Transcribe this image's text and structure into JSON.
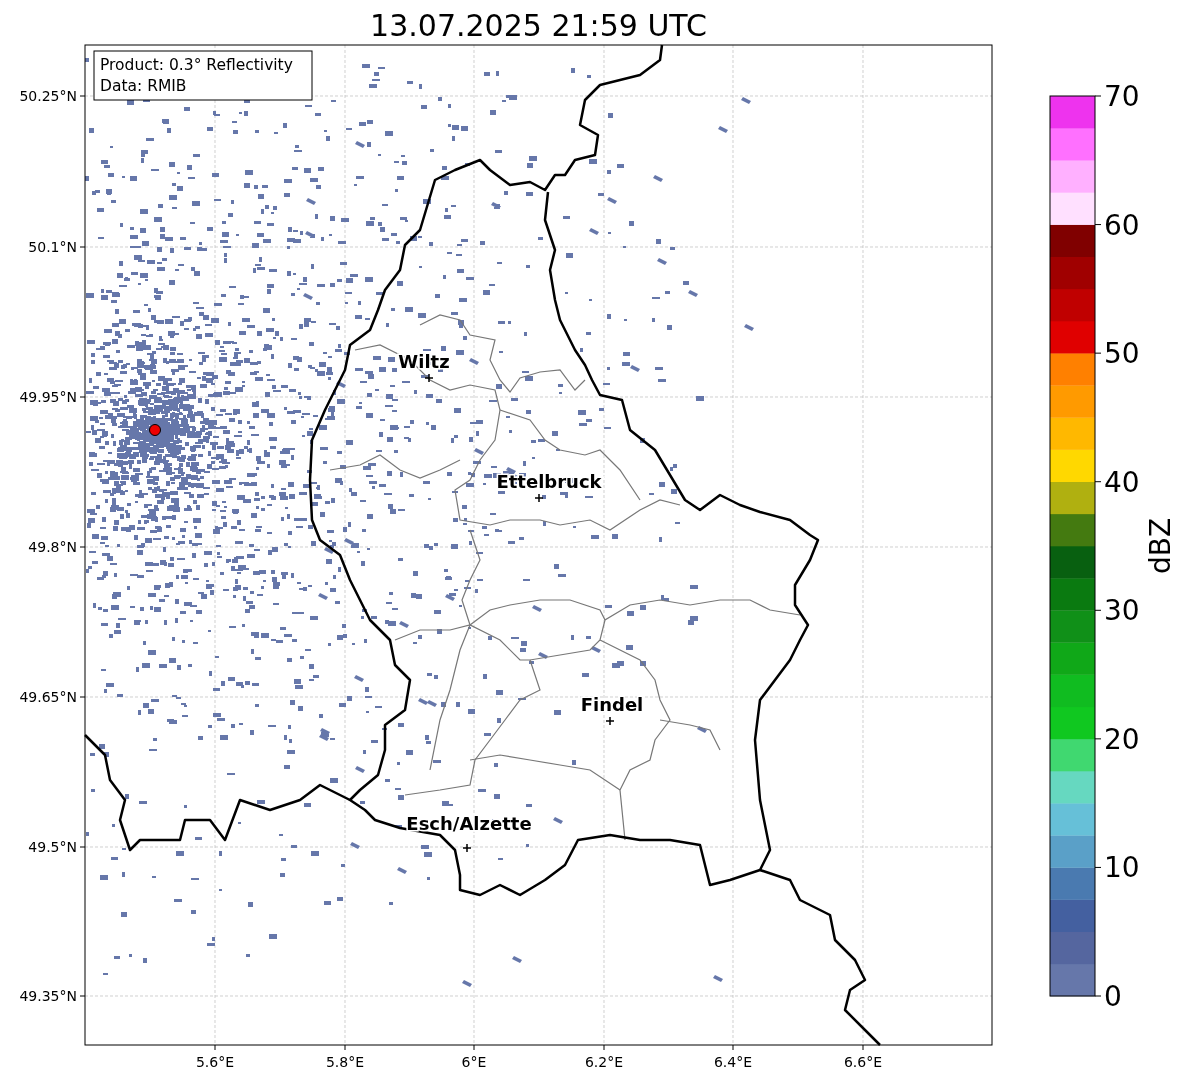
{
  "title": "13.07.2025 21:59 UTC",
  "info_box": [
    "Product: 0.3° Reflectivity",
    "Data: RMIB"
  ],
  "cities": [
    {
      "name": "Wiltz"
    },
    {
      "name": "Ettelbruck"
    },
    {
      "name": "Findel"
    },
    {
      "name": "Esch/Alzette"
    }
  ],
  "x_ticks": [
    "5.6°E",
    "5.8°E",
    "6°E",
    "6.2°E",
    "6.4°E",
    "6.6°E"
  ],
  "y_ticks": [
    "50.25°N",
    "50.1°N",
    "49.95°N",
    "49.8°N",
    "49.65°N",
    "49.5°N",
    "49.35°N"
  ],
  "colorbar": {
    "label": "dBZ",
    "ticks": [
      "70",
      "60",
      "50",
      "40",
      "30",
      "20",
      "10",
      "0"
    ],
    "segments": [
      {
        "color": "#6677aa"
      },
      {
        "color": "#55669f"
      },
      {
        "color": "#4460a0"
      },
      {
        "color": "#4a7ab0"
      },
      {
        "color": "#5aa0c8"
      },
      {
        "color": "#66c0d8"
      },
      {
        "color": "#66d8c0"
      },
      {
        "color": "#40d870"
      },
      {
        "color": "#10c820"
      },
      {
        "color": "#10bc20"
      },
      {
        "color": "#10a818"
      },
      {
        "color": "#109018"
      },
      {
        "color": "#0a7a10"
      },
      {
        "color": "#086010"
      },
      {
        "color": "#447a10"
      },
      {
        "color": "#b0b010"
      },
      {
        "color": "#ffd800"
      },
      {
        "color": "#ffb800"
      },
      {
        "color": "#ff9a00"
      },
      {
        "color": "#ff8000"
      },
      {
        "color": "#e00000"
      },
      {
        "color": "#c00000"
      },
      {
        "color": "#a00000"
      },
      {
        "color": "#800000"
      },
      {
        "color": "#ffe0ff"
      },
      {
        "color": "#ffb0ff"
      },
      {
        "color": "#ff70ff"
      },
      {
        "color": "#ee33ee"
      }
    ]
  }
}
